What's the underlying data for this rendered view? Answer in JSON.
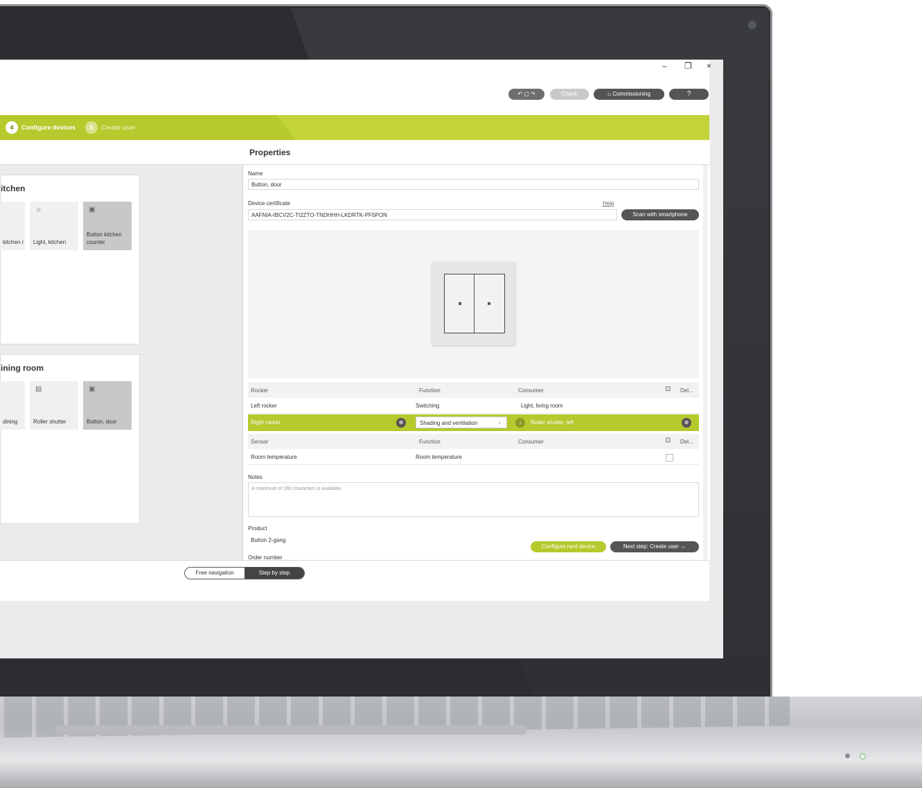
{
  "window": {
    "minimize": "–",
    "restore": "❐",
    "close": "×"
  },
  "toolbar": {
    "check_label": "Check",
    "commissioning_label": "Commissioning",
    "help_label": "?"
  },
  "steps": [
    {
      "num": "4",
      "label": "Configure devices"
    },
    {
      "num": "5",
      "label": "Create user"
    }
  ],
  "rooms": [
    {
      "title": "itchen",
      "tiles": [
        "kitchen r",
        "Light, kitchen",
        "Button kitchen counter"
      ]
    },
    {
      "title": "ining room",
      "tiles": [
        "dining",
        "Roller shutter",
        "Button, door"
      ]
    }
  ],
  "properties": {
    "title": "Properties",
    "name_label": "Name",
    "name_value": "Button, door",
    "cert_label": "Device certificate",
    "help_link": "Help",
    "cert_value": "AAFNIA-IBCV2C-TI2ZTO-TNDHHH-LKDRTK-PF5PON",
    "scan_button": "Scan with smartphone",
    "rocker_header": {
      "c1": "Rocker",
      "c2": "Function",
      "c3": "Consumer",
      "c4": "Del..."
    },
    "rocker_rows": [
      {
        "c1": "Left rocker",
        "c2": "Switching",
        "c3": "Light, living room"
      },
      {
        "c1": "Right rocker",
        "c2": "Shading and ventilation",
        "c3": "Roller shutter, left"
      }
    ],
    "sensor_header": {
      "c1": "Sensor",
      "c2": "Function",
      "c3": "Consumer",
      "c4": "Del..."
    },
    "sensor_rows": [
      {
        "c1": "Room temperature",
        "c2": "Room temperature"
      }
    ],
    "notes_label": "Notes",
    "notes_placeholder": "A maximum of 280 characters is available.",
    "product_label": "Product",
    "product_value": "Button 2-gang",
    "order_label": "Order number"
  },
  "actions": {
    "configure_next": "Configure next device",
    "next_step": "Next step: Create user →"
  },
  "nav_toggle": {
    "free": "Free navigation",
    "step": "Step by step"
  },
  "colors": {
    "accent": "#b6c92d",
    "laptop_body": "#2b2d30",
    "dark_button": "#555555"
  }
}
